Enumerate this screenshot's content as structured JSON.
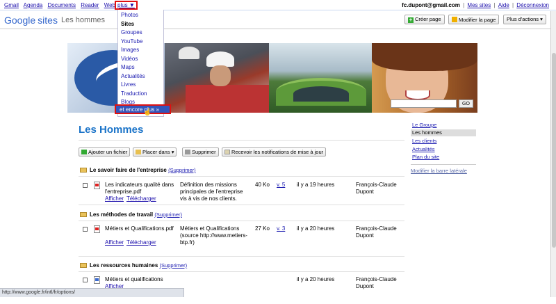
{
  "topbar": {
    "links": [
      "Gmail",
      "Agenda",
      "Documents",
      "Reader",
      "Web"
    ],
    "more_label": "plus ▼",
    "account_email": "fc.dupont@gmail.com",
    "right_links": [
      "Mes sites",
      "Aide",
      "Déconnexion"
    ]
  },
  "header": {
    "logo_google": "Google",
    "logo_sites": "sites",
    "site_name": "Les hommes",
    "create_label": "Créer page",
    "edit_label": "Modifier la page",
    "actions_label": "Plus d'actions ▾"
  },
  "dropdown": {
    "items": [
      "Photos",
      "Sites",
      "Groupes",
      "YouTube",
      "Images",
      "Vidéos",
      "Maps",
      "Actualités",
      "Livres",
      "Traduction",
      "Blogs"
    ],
    "more_label": "et encore plus »"
  },
  "banner": {
    "go_label": "GO"
  },
  "page": {
    "title": "Les Hommes"
  },
  "toolbar": {
    "add_label": "Ajouter un fichier",
    "place_label": "Placer dans ▾",
    "delete_label": "Supprimer",
    "notify_label": "Recevoir les notifications de mise à jour"
  },
  "sections": [
    {
      "title": "Le savoir faire de l'entreprise",
      "delete_label": "(Supprimer)",
      "files": [
        {
          "name": "Les indicateurs qualité dans l'entreprise.pdf",
          "icon": "pdf-icon",
          "desc": "Définition des missions principales de l'entreprise vis à vis de nos clients.",
          "size": "40 Ko",
          "version": "v. 5",
          "time": "il y a 19 heures",
          "author": "François-Claude Dupont",
          "view": "Afficher",
          "download": "Télécharger"
        }
      ]
    },
    {
      "title": "Les méthodes de travail",
      "delete_label": "(Supprimer)",
      "files": [
        {
          "name": "Métiers et Qualifications.pdf",
          "icon": "pdf-icon",
          "desc": "Métiers et Qualifications (source http://www.metiers-btp.fr)",
          "size": "27 Ko",
          "version": "v. 3",
          "time": "il y a 20 heures",
          "author": "François-Claude Dupont",
          "view": "Afficher",
          "download": "Télécharger"
        }
      ]
    },
    {
      "title": "Les ressources humaines",
      "delete_label": "(Supprimer)",
      "files": [
        {
          "name": "Métiers et qualifications",
          "icon": "doc-icon",
          "time": "il y a 20 heures",
          "author": "François-Claude Dupont",
          "view": "Afficher"
        }
      ]
    }
  ],
  "sidebar": {
    "items": [
      "Le Groupe",
      "Les hommes",
      "Les clients",
      "Actualités",
      "Plan du site"
    ],
    "active": "Les hommes",
    "edit_label": "Modifier la barre latérale"
  },
  "statusbar": {
    "text": "http://www.google.fr/intl/fr/options/"
  }
}
